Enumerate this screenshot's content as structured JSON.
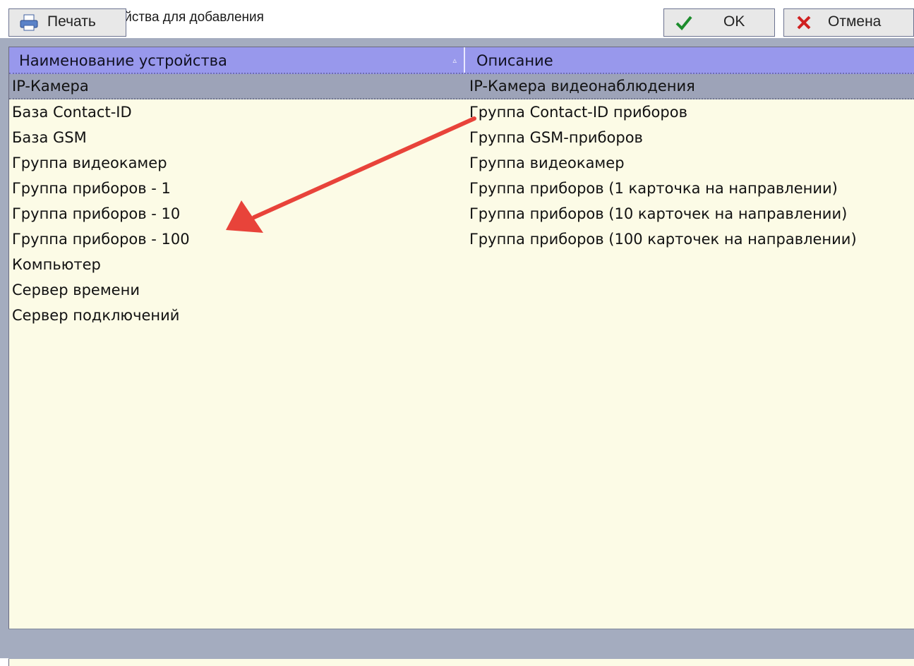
{
  "window": {
    "title": "Выбор устройства для добавления",
    "close_glyph": "✕"
  },
  "grid": {
    "columns": [
      "Наименование устройства",
      "Описание"
    ],
    "sort_indicator": "▵",
    "selected_row": 0,
    "rows": [
      [
        "IP-Камера",
        "IP-Камера видеонаблюдения"
      ],
      [
        "База Contact-ID",
        "Группа Contact-ID приборов"
      ],
      [
        "База GSM",
        "Группа GSM-приборов"
      ],
      [
        "Группа видеокамер",
        "Группа видеокамер"
      ],
      [
        "Группа приборов - 1",
        "Группа приборов (1 карточка на направлении)"
      ],
      [
        "Группа приборов - 10",
        "Группа приборов (10 карточек на направлении)"
      ],
      [
        "Группа приборов - 100",
        "Группа приборов (100 карточек на направлении)"
      ],
      [
        "Компьютер",
        ""
      ],
      [
        "Сервер времени",
        ""
      ],
      [
        "Сервер подключений",
        ""
      ]
    ]
  },
  "buttons": {
    "print": "Печать",
    "ok": "OK",
    "cancel": "Отмена"
  },
  "colors": {
    "header": "#9898ec",
    "selected_row": "#9da3b8",
    "grid_background": "#fcfbe6",
    "frame": "#a4acbf",
    "annotation_arrow": "#e8433a"
  },
  "icons": {
    "window": "app-monitor-icon",
    "print": "printer-icon",
    "ok": "checkmark-icon",
    "cancel": "red-x-icon"
  }
}
